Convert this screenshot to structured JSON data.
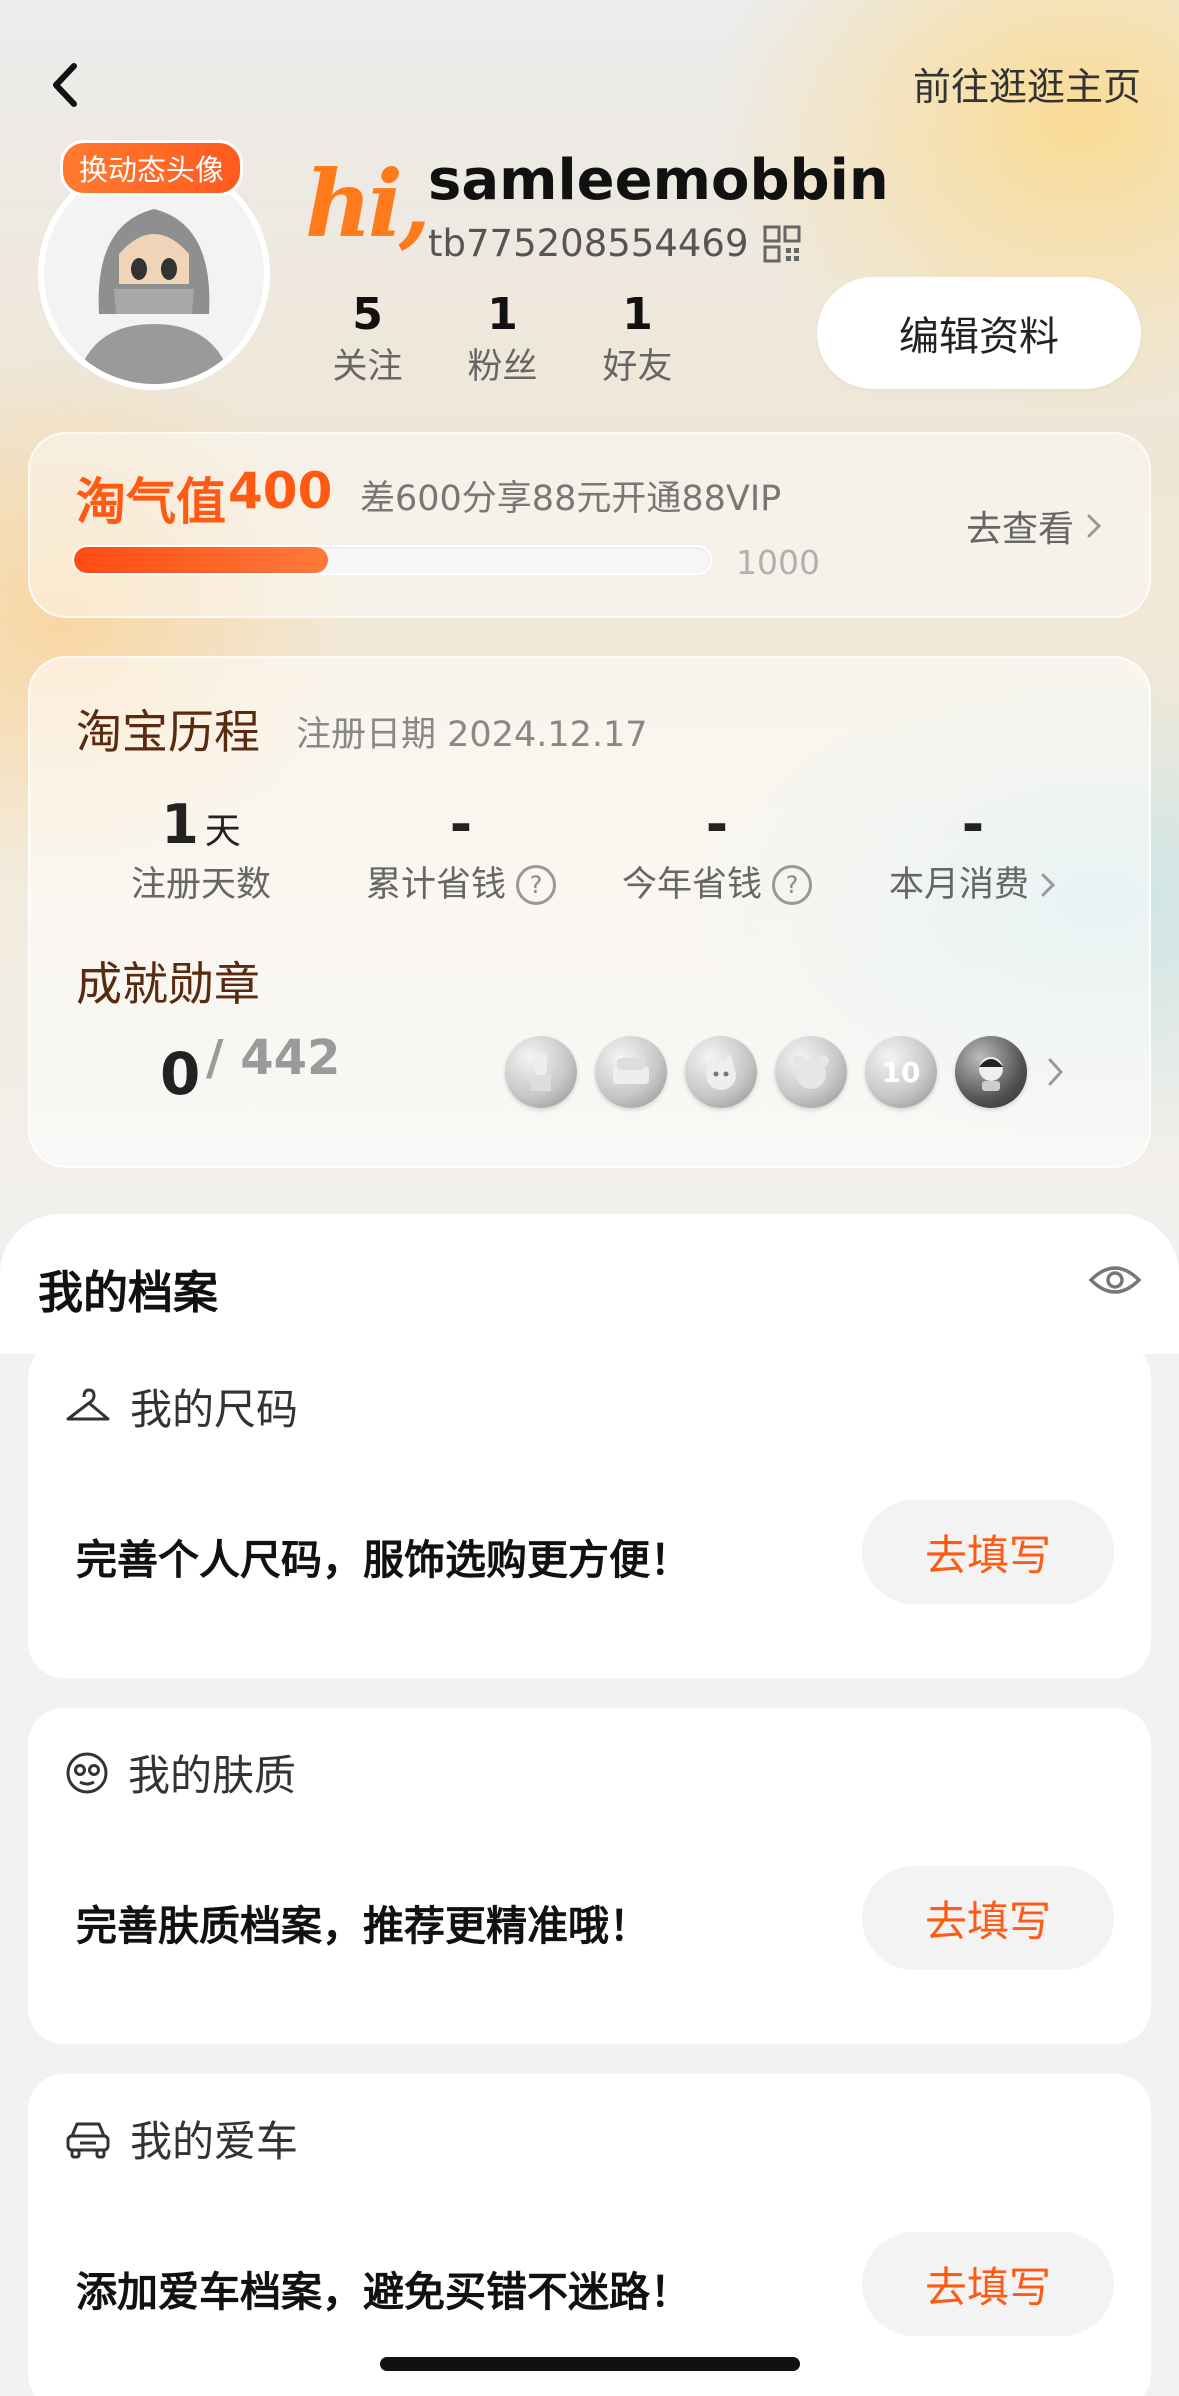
{
  "header": {
    "visit_link": "前往逛逛主页"
  },
  "profile": {
    "avatar_badge": "换动态头像",
    "greeting": "hi,",
    "username": "samleemobbin",
    "user_id": "tb775208554469",
    "edit_button": "编辑资料",
    "stats": [
      {
        "value": "5",
        "label": "关注"
      },
      {
        "value": "1",
        "label": "粉丝"
      },
      {
        "value": "1",
        "label": "好友"
      }
    ]
  },
  "taoqi": {
    "label": "淘气值",
    "value": "400",
    "description": "差600分享88元开通88VIP",
    "max": "1000",
    "progress_fraction": 0.4,
    "view_link": "去查看",
    "accent_color": "#ff5a14"
  },
  "history": {
    "title": "淘宝历程",
    "registered": "注册日期 2024.12.17",
    "metrics": [
      {
        "value": "1",
        "unit": "天",
        "label": "注册天数"
      },
      {
        "value": "-",
        "unit": "",
        "label": "累计省钱"
      },
      {
        "value": "-",
        "unit": "",
        "label": "今年省钱"
      },
      {
        "value": "-",
        "unit": "",
        "label": "本月消费"
      }
    ],
    "help_glyph": "?",
    "badges_title": "成就勋章",
    "badges_earned": "0",
    "badges_total": "/ 442",
    "badge_icons": [
      "lipstick-badge-icon",
      "sofa-badge-icon",
      "cat-badge-icon",
      "bear-badge-icon",
      "ten-badge-icon",
      "character-badge-icon"
    ],
    "badge_ten_text": "10"
  },
  "archive": {
    "title": "我的档案",
    "cards": [
      {
        "title": "我的尺码",
        "icon": "hanger-icon",
        "text": "完善个人尺码，服饰选购更方便！",
        "button": "去填写"
      },
      {
        "title": "我的肤质",
        "icon": "face-icon",
        "text": "完善肤质档案，推荐更精准哦！",
        "button": "去填写"
      },
      {
        "title": "我的爱车",
        "icon": "car-icon",
        "text": "添加爱车档案，避免买错不迷路！",
        "button": "去填写"
      }
    ]
  }
}
